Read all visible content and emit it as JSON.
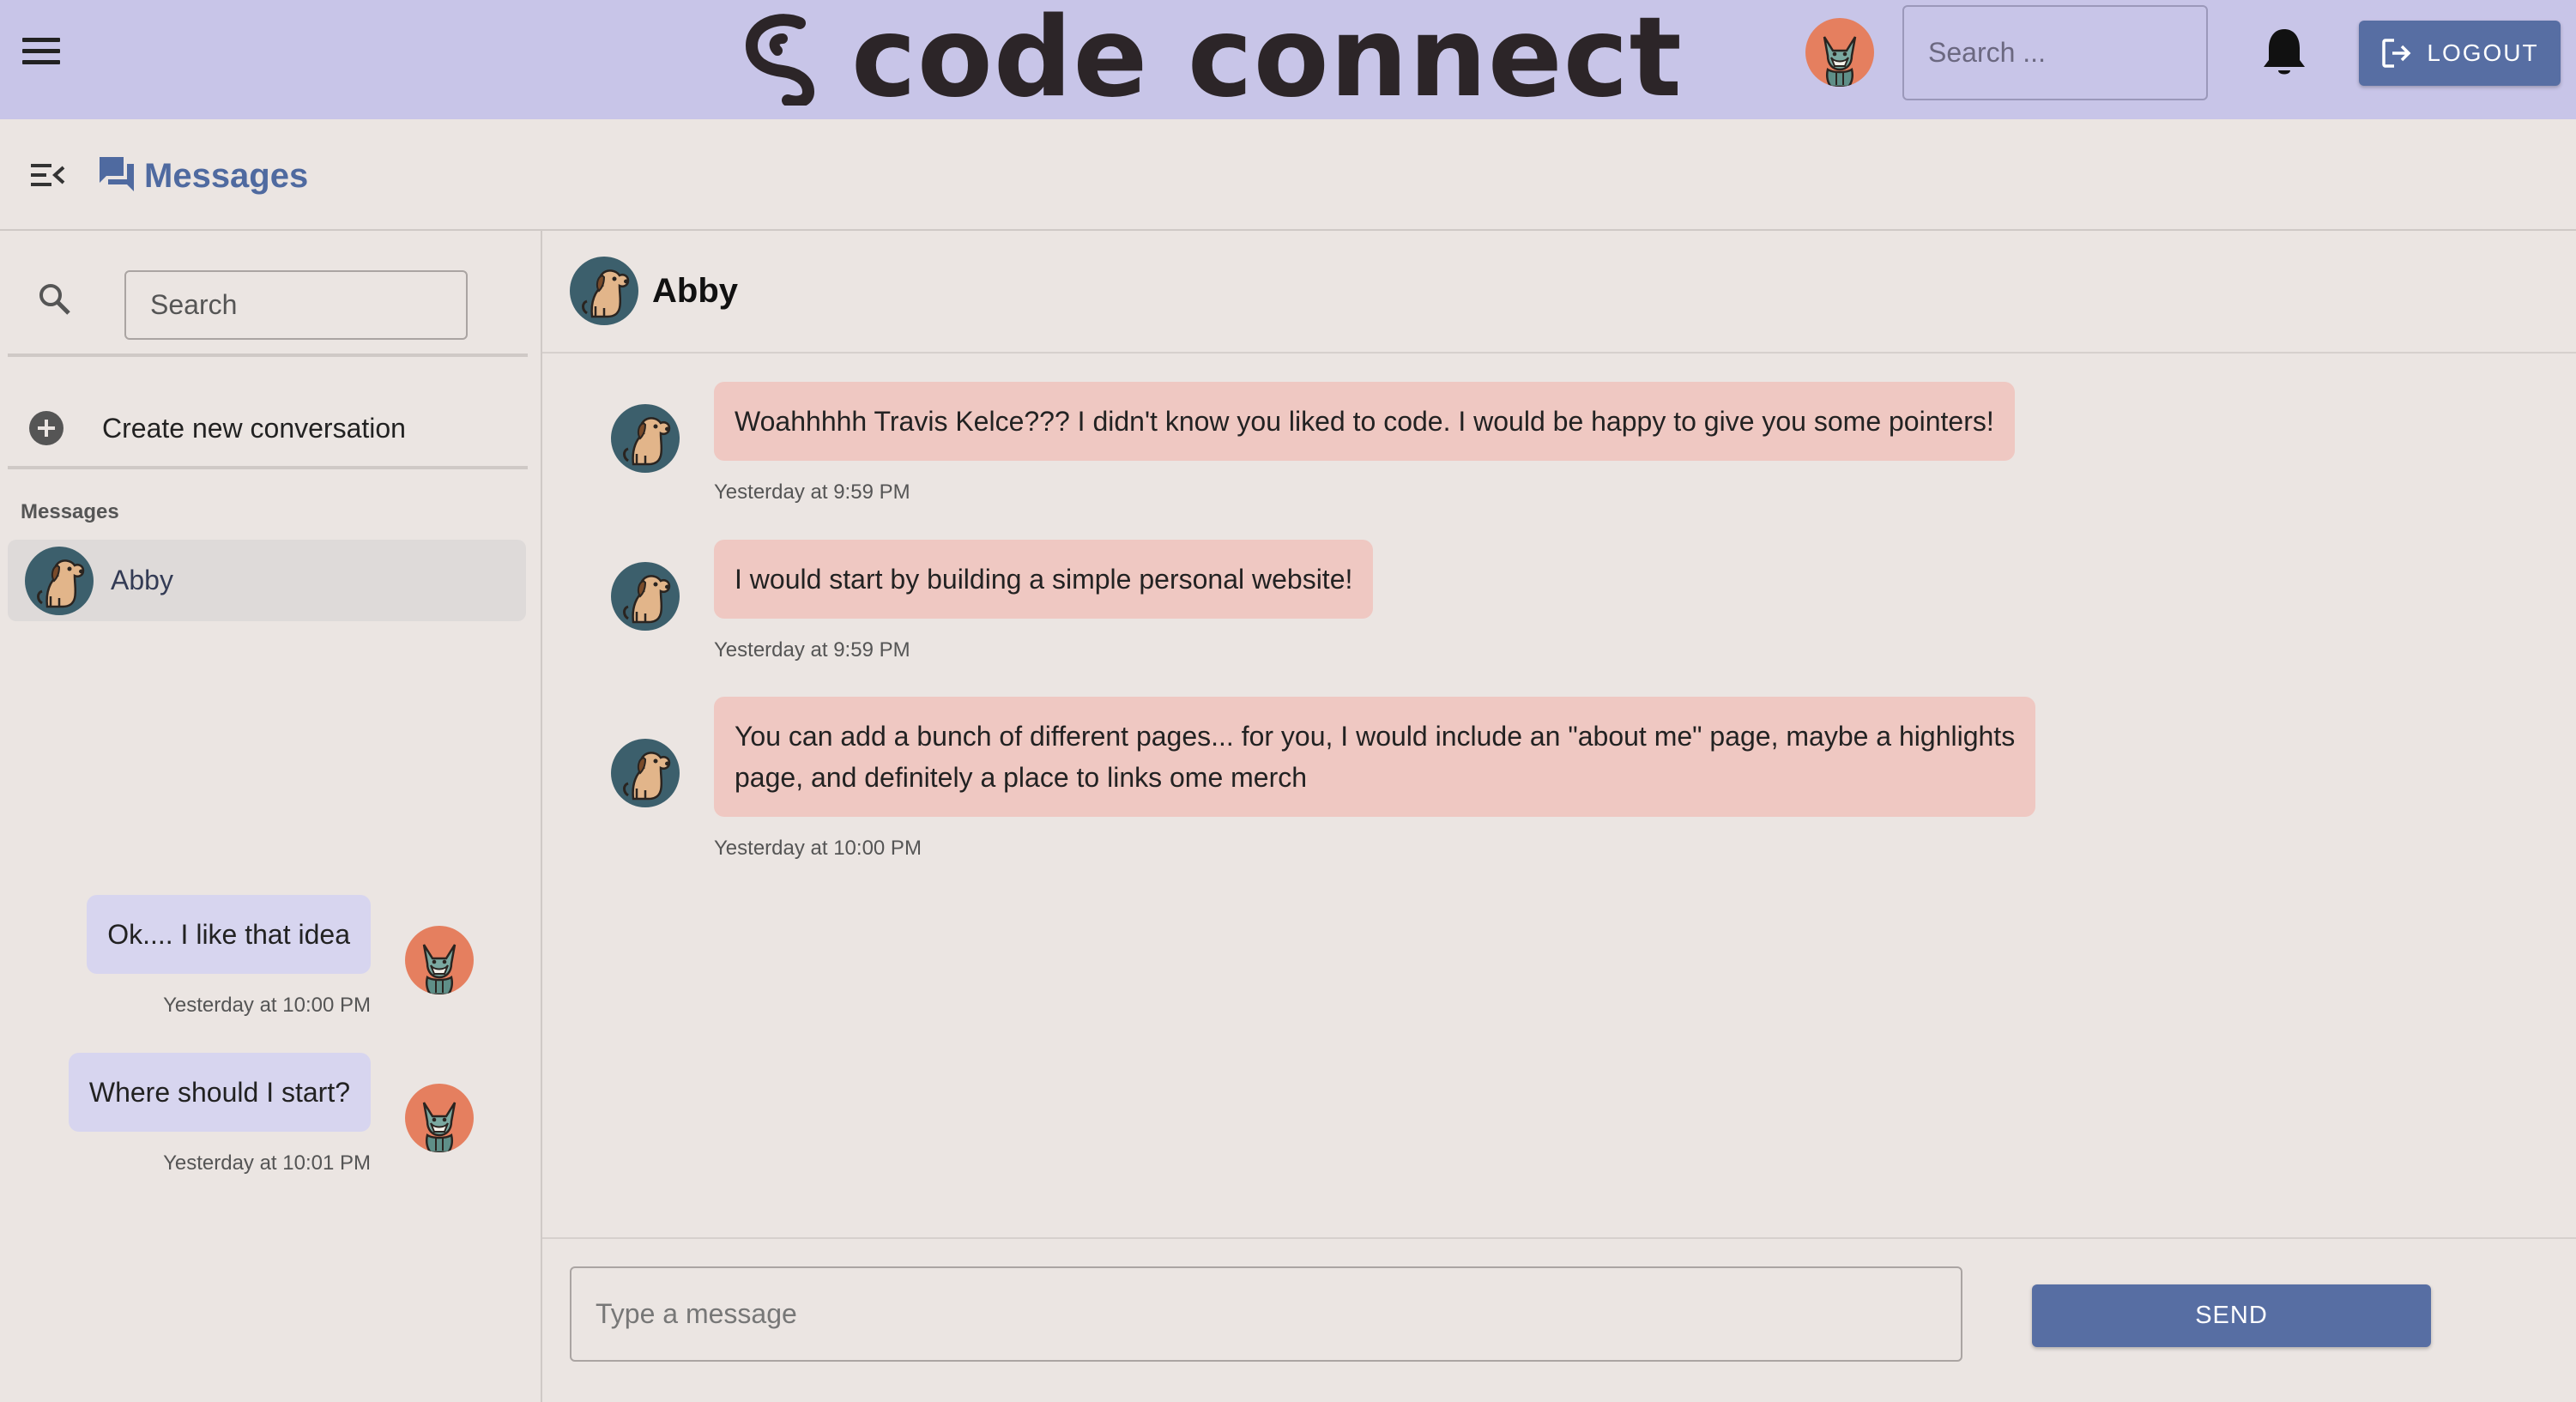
{
  "topbar": {
    "menu_icon": "hamburger-menu-icon",
    "brand": "code connect",
    "brand_icon": "code-connect-logo-icon",
    "search_placeholder": "Search ...",
    "notifications_icon": "bell-icon",
    "logout_label": "LOGOUT",
    "logout_icon": "logout-icon",
    "user_avatar": "fox-avatar"
  },
  "subheader": {
    "collapse_icon": "menu-collapse-icon",
    "title_icon": "chat-bubbles-icon",
    "title": "Messages"
  },
  "sidebar": {
    "search_icon": "search-icon",
    "search_placeholder": "Search",
    "create_icon": "add-circle-icon",
    "create_label": "Create new conversation",
    "section_label": "Messages",
    "conversations": [
      {
        "name": "Abby",
        "avatar": "dog-avatar",
        "selected": true
      }
    ]
  },
  "chat": {
    "contact_name": "Abby",
    "contact_avatar": "dog-avatar",
    "messages": [
      {
        "direction": "incoming",
        "lines": [
          "Woahhhhh Travis Kelce??? I didn't know you liked to code. I would be happy to give you some pointers!"
        ],
        "time": "Yesterday at 9:59 PM"
      },
      {
        "direction": "incoming",
        "lines": [
          "I would start by building a simple personal website!"
        ],
        "time": "Yesterday at 9:59 PM"
      },
      {
        "direction": "incoming",
        "lines": [
          "You can add a bunch of different pages... for you, I would include an \"about me\" page, maybe a highlights",
          "page, and definitely a place to links ome merch"
        ],
        "time": "Yesterday at 10:00 PM"
      },
      {
        "direction": "outgoing",
        "lines": [
          "Ok.... I like that idea"
        ],
        "time": "Yesterday at 10:00 PM"
      },
      {
        "direction": "outgoing",
        "lines": [
          "Where should I start?"
        ],
        "time": "Yesterday at 10:01 PM"
      }
    ],
    "composer_placeholder": "Type a message",
    "send_label": "SEND"
  },
  "colors": {
    "topbar_bg": "#c8c5e8",
    "page_bg": "#ebe5e2",
    "accent": "#576ea3",
    "incoming_bubble": "#efc8c2",
    "outgoing_bubble": "#d7d5ef"
  }
}
